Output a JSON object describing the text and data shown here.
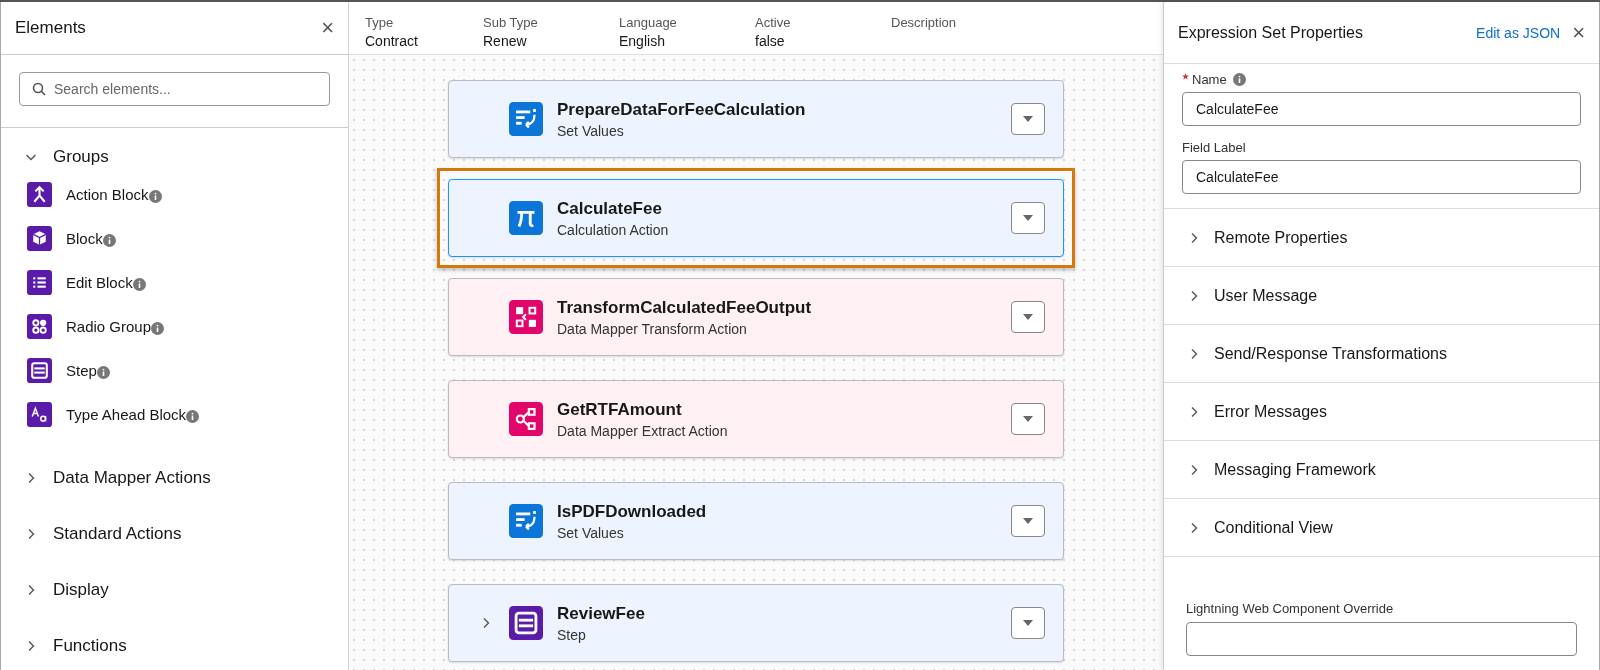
{
  "elements_panel": {
    "title": "Elements",
    "close": "×",
    "search": {
      "placeholder": "Search elements..."
    },
    "sections": [
      {
        "label": "Groups",
        "expanded": true,
        "items": [
          {
            "label": "Action Block",
            "kind": "action-block"
          },
          {
            "label": "Block",
            "kind": "block"
          },
          {
            "label": "Edit Block",
            "kind": "edit-block"
          },
          {
            "label": "Radio Group",
            "kind": "radio-group"
          },
          {
            "label": "Step",
            "kind": "step"
          },
          {
            "label": "Type Ahead Block",
            "kind": "type-ahead"
          }
        ]
      },
      {
        "label": "Data Mapper Actions",
        "expanded": false
      },
      {
        "label": "Standard Actions",
        "expanded": false
      },
      {
        "label": "Display",
        "expanded": false
      },
      {
        "label": "Functions",
        "expanded": false
      }
    ]
  },
  "header_fields": [
    {
      "label": "Type",
      "value": "Contract"
    },
    {
      "label": "Sub Type",
      "value": "Renew"
    },
    {
      "label": "Language",
      "value": "English"
    },
    {
      "label": "Active",
      "value": "false"
    },
    {
      "label": "Description"
    }
  ],
  "canvas": {
    "nodes": [
      {
        "name": "PrepareDataForFeeCalculation",
        "type": "Set Values",
        "kind": "set-values",
        "selected": false
      },
      {
        "name": "CalculateFee",
        "type": "Calculation Action",
        "kind": "calculation",
        "selected": true
      },
      {
        "name": "TransformCalculatedFeeOutput",
        "type": "Data Mapper Transform Action",
        "kind": "dm-transform",
        "selected": false
      },
      {
        "name": "GetRTFAmount",
        "type": "Data Mapper Extract Action",
        "kind": "dm-extract",
        "selected": false
      },
      {
        "name": "IsPDFDownloaded",
        "type": "Set Values",
        "kind": "set-values",
        "selected": false
      },
      {
        "name": "ReviewFee",
        "type": "Step",
        "kind": "step",
        "selected": false
      }
    ]
  },
  "properties_panel": {
    "title": "Expression Set Properties",
    "edit_link": "Edit as JSON",
    "close": "×",
    "fields": [
      {
        "label": "Name",
        "required": true,
        "info": true,
        "value": "CalculateFee"
      },
      {
        "label": "Field Label",
        "required": false,
        "info": false,
        "value": "CalculateFee"
      }
    ],
    "sections": [
      {
        "label": "Remote Properties",
        "expanded": false
      },
      {
        "label": "User Message",
        "expanded": false
      },
      {
        "label": "Send/Response Transformations",
        "expanded": false
      },
      {
        "label": "Error Messages",
        "expanded": false
      },
      {
        "label": "Messaging Framework",
        "expanded": false
      },
      {
        "label": "Conditional View",
        "expanded": false
      }
    ],
    "override_field": {
      "label": "Lightning Web Component Override"
    }
  }
}
